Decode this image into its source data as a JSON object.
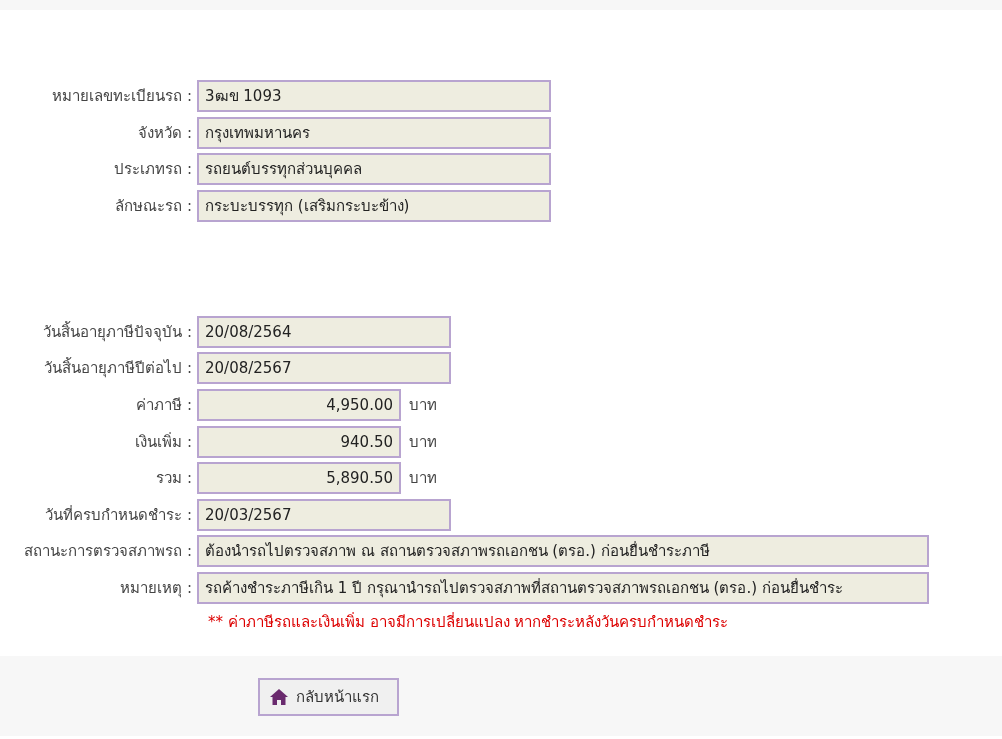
{
  "vehicle_fields": [
    {
      "label": "หมายเลขทะเบียนรถ :",
      "value": "3ฒข 1093",
      "kind": "wide"
    },
    {
      "label": "จังหวัด :",
      "value": "กรุงเทพมหานคร",
      "kind": "wide"
    },
    {
      "label": "ประเภทรถ :",
      "value": "รถยนต์บรรทุกส่วนบุคคล",
      "kind": "wide"
    },
    {
      "label": "ลักษณะรถ :",
      "value": "กระบะบรรทุก (เสริมกระบะข้าง)",
      "kind": "wide"
    }
  ],
  "tax_fields": [
    {
      "label": "วันสิ้นอายุภาษีปัจจุบัน :",
      "value": "20/08/2564",
      "kind": "date"
    },
    {
      "label": "วันสิ้นอายุภาษีปีต่อไป :",
      "value": "20/08/2567",
      "kind": "date"
    },
    {
      "label": "ค่าภาษี :",
      "value": "4,950.00",
      "kind": "money",
      "unit": "บาท"
    },
    {
      "label": "เงินเพิ่ม :",
      "value": "940.50",
      "kind": "money",
      "unit": "บาท"
    },
    {
      "label": "รวม :",
      "value": "5,890.50",
      "kind": "money",
      "unit": "บาท"
    },
    {
      "label": "วันที่ครบกำหนดชำระ :",
      "value": "20/03/2567",
      "kind": "date"
    },
    {
      "label": "สถานะการตรวจสภาพรถ :",
      "value": "ต้องนำรถไปตรวจสภาพ ณ สถานตรวจสภาพรถเอกชน (ตรอ.) ก่อนยื่นชำระภาษี",
      "kind": "full"
    },
    {
      "label": "หมายเหตุ :",
      "value": "รถค้างชำระภาษีเกิน 1 ปี กรุณานำรถไปตรวจสภาพที่สถานตรวจสภาพรถเอกชน (ตรอ.) ก่อนยื่นชำระ",
      "kind": "full"
    }
  ],
  "warning": "** ค่าภาษีรถและเงินเพิ่ม อาจมีการเปลี่ยนแปลง หากชำระหลังวันครบกำหนดชำระ",
  "home_button": {
    "label": "กลับหน้าแรก"
  }
}
